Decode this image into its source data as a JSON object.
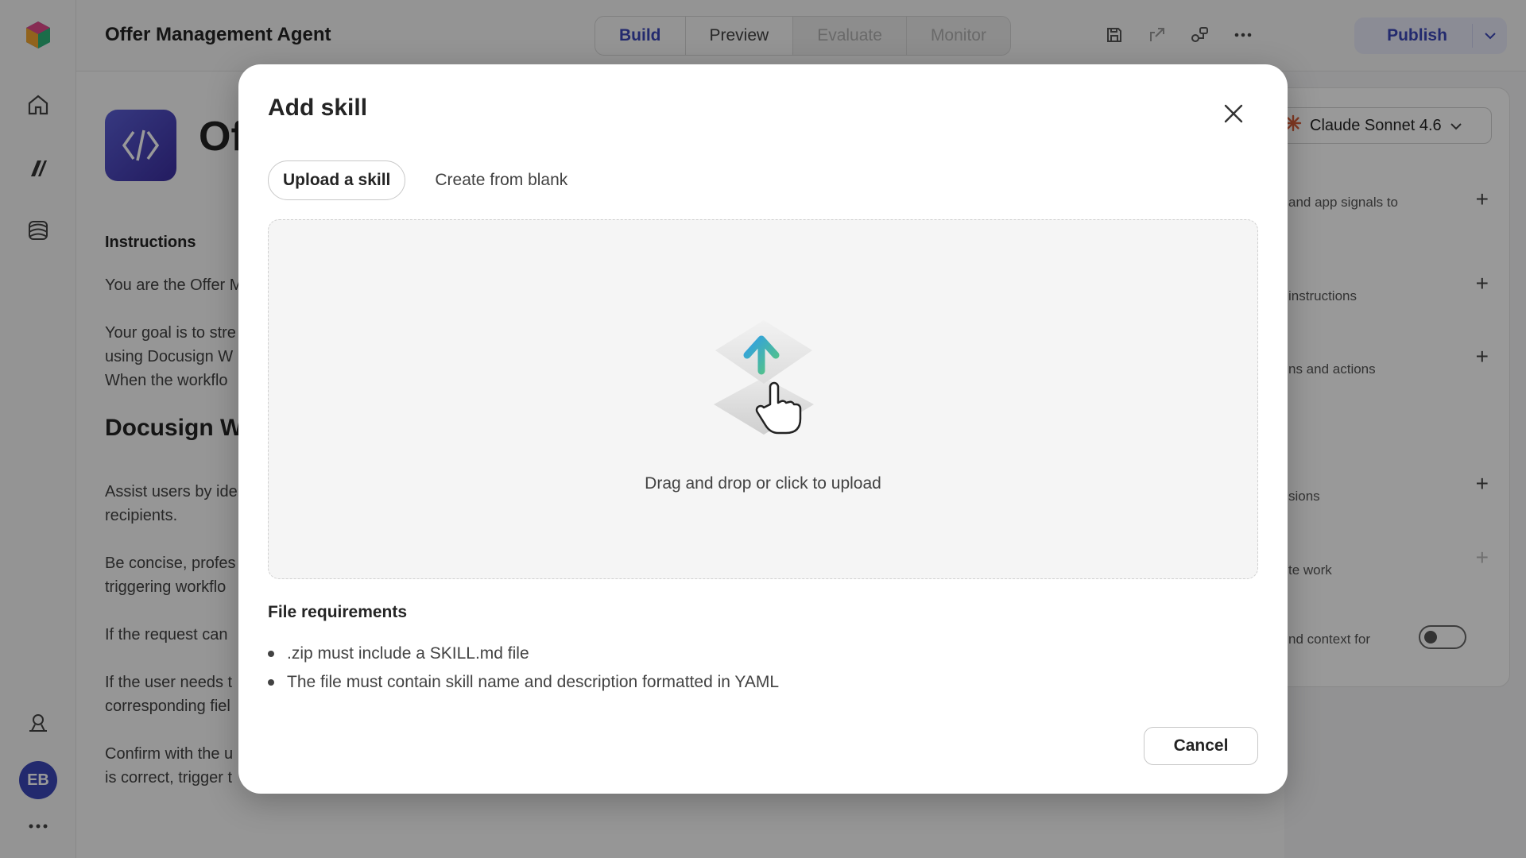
{
  "app": {
    "title": "Offer Management Agent",
    "tabs": [
      {
        "label": "Build",
        "state": "active"
      },
      {
        "label": "Preview",
        "state": "enabled"
      },
      {
        "label": "Evaluate",
        "state": "disabled"
      },
      {
        "label": "Monitor",
        "state": "disabled"
      }
    ],
    "publish_label": "Publish",
    "avatar_initials": "EB",
    "accent_color": "#3b46b8"
  },
  "background": {
    "agent_name": "Of",
    "instructions_label": "Instructions",
    "lines": [
      "You are the Offer M",
      "Your goal is to stre",
      "using Docusign W",
      "When the workflo",
      "Assist users by ide",
      "recipients.",
      "Be concise, profes",
      "triggering workflo",
      "If the request can",
      "If the user needs t",
      "corresponding fiel",
      "Confirm with the u",
      "is correct, trigger t"
    ],
    "heading": "Docusign Wo",
    "model": "Claude Sonnet 4.6",
    "panel_rows": [
      "and app signals to",
      "instructions",
      "ns and actions",
      "sions",
      "te work",
      "nd context for"
    ]
  },
  "modal": {
    "title": "Add skill",
    "tabs": [
      {
        "label": "Upload a skill",
        "active": true
      },
      {
        "label": "Create from blank",
        "active": false
      }
    ],
    "dropzone_text": "Drag and drop or click to upload",
    "requirements_title": "File requirements",
    "requirements": [
      ".zip must include a SKILL.md file",
      "The file must contain skill name and description formatted in YAML"
    ],
    "cancel_label": "Cancel"
  }
}
